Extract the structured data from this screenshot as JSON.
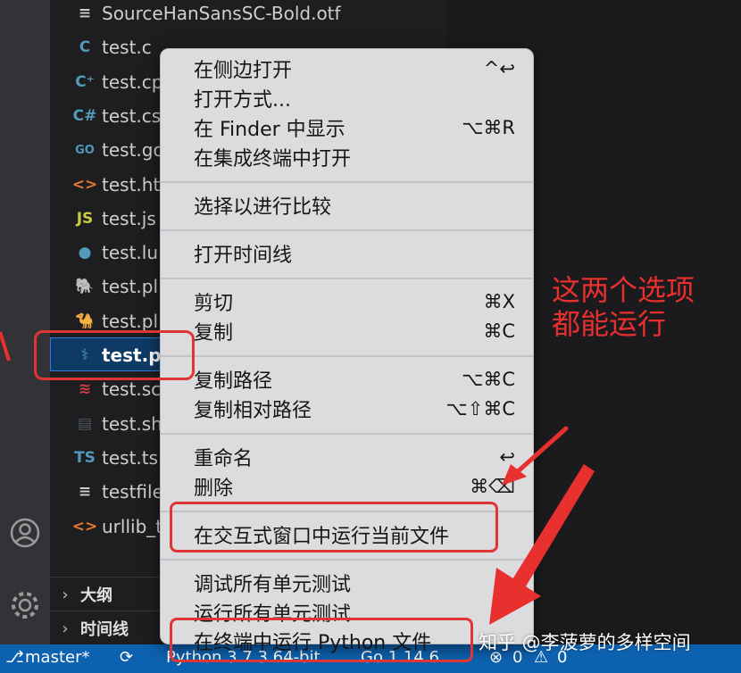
{
  "explorer": {
    "files": [
      {
        "name": "SourceHanSansSC-Bold.otf",
        "icon": "lines-icon",
        "color": "#cfcfcf"
      },
      {
        "name": "test.c",
        "icon": "c-icon",
        "color": "#519aba"
      },
      {
        "name": "test.cp",
        "icon": "cpp-icon",
        "color": "#519aba"
      },
      {
        "name": "test.cs",
        "icon": "csharp-icon",
        "color": "#519aba"
      },
      {
        "name": "test.go",
        "icon": "go-icon",
        "color": "#519aba"
      },
      {
        "name": "test.ht",
        "icon": "html-icon",
        "color": "#e37933"
      },
      {
        "name": "test.js",
        "icon": "js-icon",
        "color": "#cbcb41"
      },
      {
        "name": "test.lu",
        "icon": "lua-icon",
        "color": "#519aba"
      },
      {
        "name": "test.pl",
        "icon": "php-icon",
        "color": "#a074c4"
      },
      {
        "name": "test.pl",
        "icon": "perl-icon",
        "color": "#519aba"
      },
      {
        "name": "test.py",
        "icon": "python-icon",
        "color": "#519aba"
      },
      {
        "name": "test.sc",
        "icon": "scala-icon",
        "color": "#cc3e44"
      },
      {
        "name": "test.sh",
        "icon": "shell-icon",
        "color": "#4d5a5e"
      },
      {
        "name": "test.ts",
        "icon": "ts-icon",
        "color": "#519aba"
      },
      {
        "name": "testfile",
        "icon": "lines-icon",
        "color": "#cfcfcf"
      },
      {
        "name": "urllib_t",
        "icon": "html-icon",
        "color": "#e37933"
      }
    ],
    "outline_label": "大纲",
    "timeline_label": "时间线"
  },
  "menu": {
    "open_side": {
      "label": "在侧边打开",
      "shortcut": "^↩"
    },
    "open_with": {
      "label": "打开方式..."
    },
    "reveal_finder": {
      "label": "在 Finder 中显示",
      "shortcut": "⌥⌘R"
    },
    "open_terminal": {
      "label": "在集成终端中打开"
    },
    "select_compare": {
      "label": "选择以进行比较"
    },
    "open_timeline": {
      "label": "打开时间线"
    },
    "cut": {
      "label": "剪切",
      "shortcut": "⌘X"
    },
    "copy": {
      "label": "复制",
      "shortcut": "⌘C"
    },
    "copy_path": {
      "label": "复制路径",
      "shortcut": "⌥⌘C"
    },
    "copy_rel_path": {
      "label": "复制相对路径",
      "shortcut": "⌥⇧⌘C"
    },
    "rename": {
      "label": "重命名",
      "shortcut": "↩"
    },
    "delete": {
      "label": "删除",
      "shortcut": "⌘⌫"
    },
    "run_interactive": {
      "label": "在交互式窗口中运行当前文件"
    },
    "debug_tests": {
      "label": "调试所有单元测试"
    },
    "run_tests": {
      "label": "运行所有单元测试"
    },
    "run_terminal": {
      "label": "在终端中运行 Python 文件"
    }
  },
  "statusbar": {
    "branch": "master*",
    "interpreter": "Python 3.7.3 64-bit",
    "version": "Go 1.14.6",
    "errors": "0",
    "warnings": "0"
  },
  "annotation": {
    "line1": "这两个选项",
    "line2": "都能运行"
  },
  "watermark": "知乎 @李菠萝的多样空间",
  "colors": {
    "annotation": "#e8302f",
    "statusbar": "#0d62b0",
    "selection": "#0e3a66",
    "menu_bg": "#dcdcdf"
  }
}
